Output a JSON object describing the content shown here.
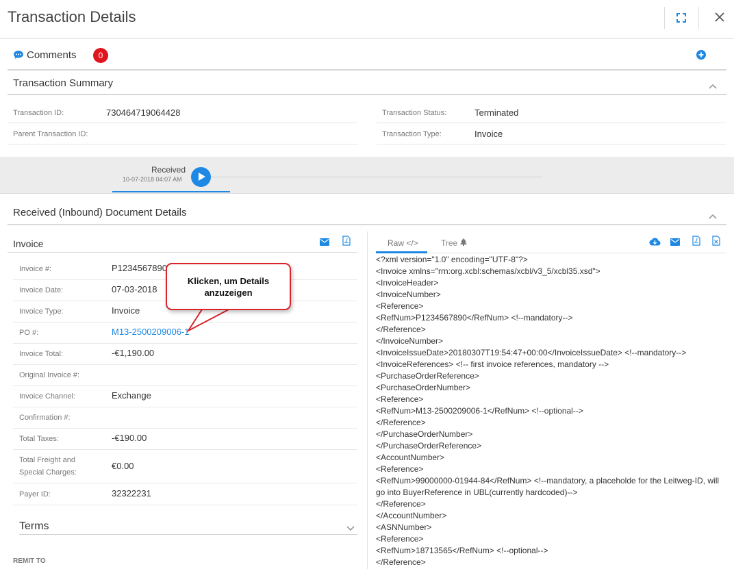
{
  "header": {
    "title": "Transaction Details"
  },
  "comments": {
    "label": "Comments",
    "count": "0"
  },
  "summary": {
    "title": "Transaction Summary",
    "transaction_id_label": "Transaction ID:",
    "transaction_id": "730464719064428",
    "parent_id_label": "Parent Transaction ID:",
    "parent_id": "",
    "status_label": "Transaction Status:",
    "status": "Terminated",
    "type_label": "Transaction Type:",
    "type": "Invoice"
  },
  "timeline": {
    "event": "Received",
    "date": "10-07-2018 04:07 AM"
  },
  "document": {
    "title": "Received (Inbound) Document Details",
    "invoice_title": "Invoice",
    "fields": [
      {
        "label": "Invoice #:",
        "value": "P1234567890"
      },
      {
        "label": "Invoice Date:",
        "value": "07-03-2018"
      },
      {
        "label": "Invoice Type:",
        "value": "Invoice"
      },
      {
        "label": "PO #:",
        "value": "M13-2500209006-1"
      },
      {
        "label": "Invoice Total:",
        "value": "-€1,190.00"
      },
      {
        "label": "Original Invoice #:",
        "value": ""
      },
      {
        "label": "Invoice Channel:",
        "value": "Exchange"
      },
      {
        "label": "Confirmation #:",
        "value": ""
      },
      {
        "label": "Total Taxes:",
        "value": "-€190.00"
      },
      {
        "label_line1": "Total Freight and",
        "label_line2": "Special Charges:",
        "value": "€0.00"
      },
      {
        "label": "Payer ID:",
        "value": "32322231"
      }
    ],
    "terms_label": "Terms",
    "remit_label": "REMIT TO"
  },
  "raw": {
    "tab_raw": "Raw </>",
    "tab_tree": "Tree",
    "lines": [
      "<?xml version=\"1.0\" encoding=\"UTF-8\"?>",
      "<Invoice xmlns=\"rrn:org.xcbl:schemas/xcbl/v3_5/xcbl35.xsd\">",
      "<InvoiceHeader>",
      "<InvoiceNumber>",
      "<Reference>",
      "<RefNum>P1234567890</RefNum> <!--mandatory-->",
      "</Reference>",
      "</InvoiceNumber>",
      "<InvoiceIssueDate>20180307T19:54:47+00:00</InvoiceIssueDate> <!--mandatory-->",
      "<InvoiceReferences> <!-- first invoice references, mandatory -->",
      "<PurchaseOrderReference>",
      "<PurchaseOrderNumber>",
      "<Reference>",
      "<RefNum>M13-2500209006-1</RefNum> <!--optional-->",
      "</Reference>",
      "</PurchaseOrderNumber>",
      "</PurchaseOrderReference>",
      "<AccountNumber>",
      "<Reference>",
      "<RefNum>99000000-01944-84</RefNum> <!--mandatory, a placeholde for the Leitweg-ID, will go into BuyerReference in UBL(currently hardcoded)-->",
      "</Reference>",
      "</AccountNumber>",
      "<ASNNumber>",
      "<Reference>",
      "<RefNum>18713565</RefNum> <!--optional-->",
      "</Reference>"
    ]
  },
  "callout": {
    "line1": "Klicken, um Details",
    "line2": "anzuzeigen"
  },
  "colors": {
    "accent": "#1e88e5",
    "badge": "#e0161e",
    "callout_border": "#d9242b"
  },
  "icons": [
    "expand-icon",
    "close-icon",
    "comment-icon",
    "add-circle-icon",
    "chevron-up-icon",
    "mail-icon",
    "pdf-icon",
    "download-cloud-icon",
    "excel-icon",
    "tree-icon",
    "play-icon",
    "chevron-down-icon"
  ]
}
